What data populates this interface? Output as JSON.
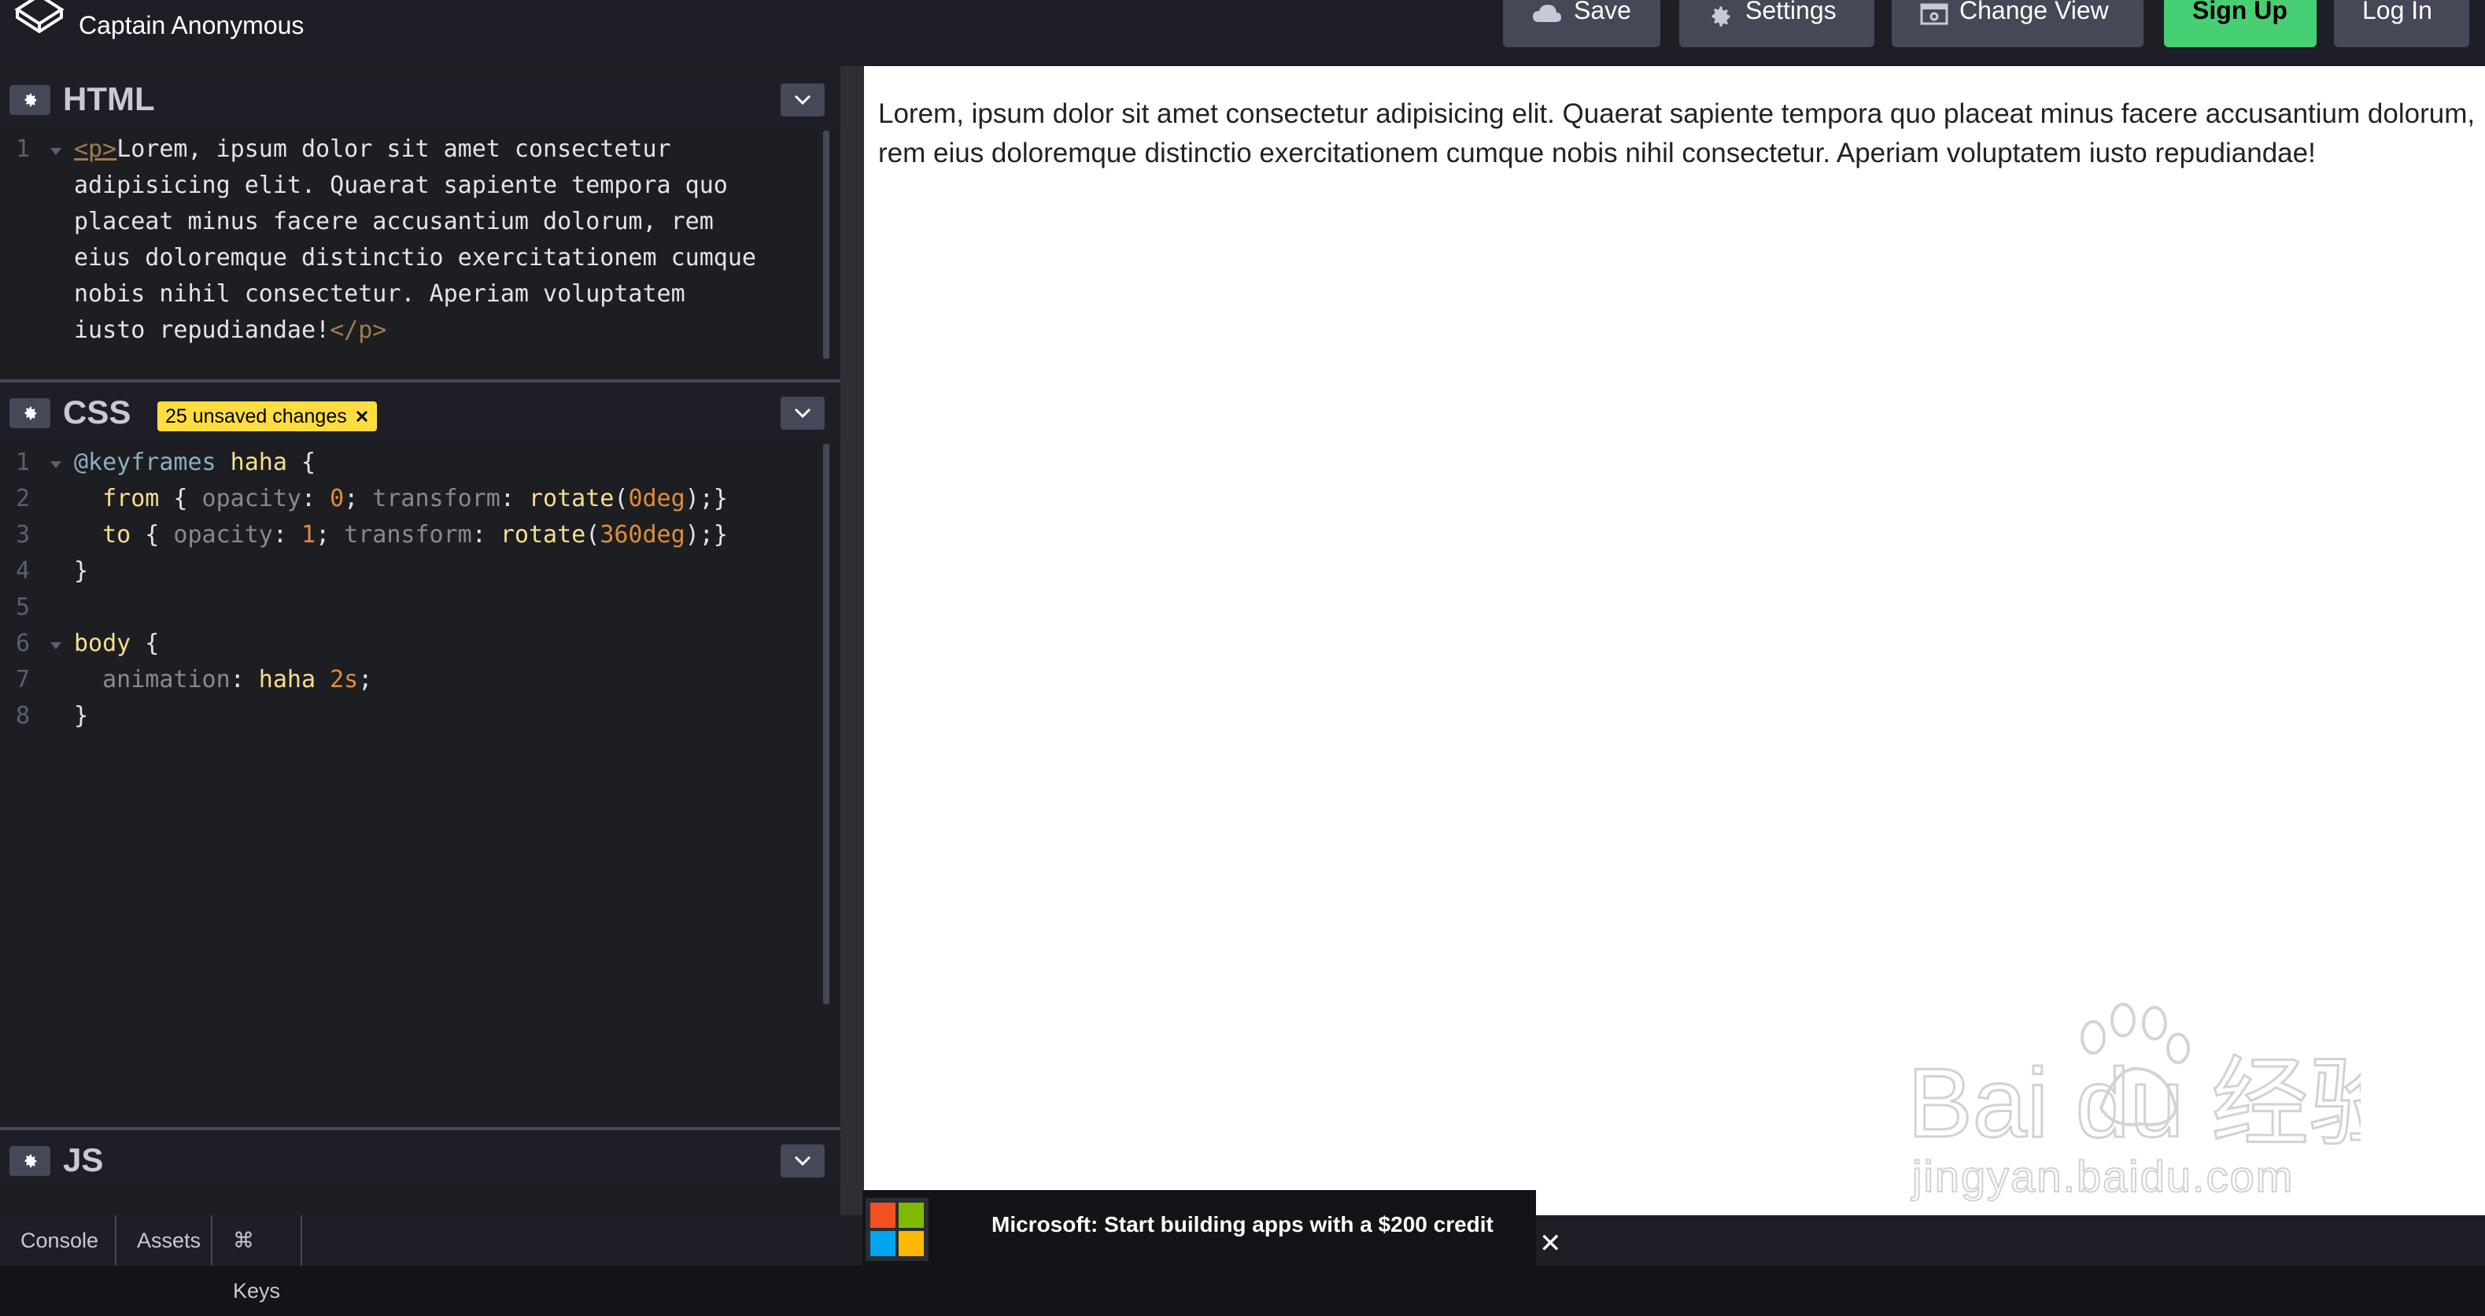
{
  "header": {
    "owner": "Captain Anonymous",
    "buttons": {
      "save": "Save",
      "settings": "Settings",
      "change_view": "Change View",
      "sign_up": "Sign Up",
      "log_in": "Log In"
    }
  },
  "panels": {
    "html": {
      "title": "HTML",
      "lines": [
        {
          "num": "1",
          "open": "<p>",
          "text": "Lorem, ipsum dolor sit amet consectetur"
        },
        {
          "text": "adipisicing elit. Quaerat sapiente tempora quo"
        },
        {
          "text": "placeat minus facere accusantium dolorum, rem"
        },
        {
          "text": "eius doloremque distinctio exercitationem cumque"
        },
        {
          "text": "nobis nihil consectetur. Aperiam voluptatem"
        },
        {
          "text": "iusto repudiandae!",
          "close": "</p>"
        }
      ]
    },
    "css": {
      "title": "CSS",
      "badge": "25 unsaved changes",
      "lines": [
        {
          "num": "1",
          "a": "@keyframes",
          "b": " haha",
          "c": " {"
        },
        {
          "num": "2",
          "from": "from",
          "p1": " {",
          "opacity": " opacity",
          "c1": ":",
          "v1": " 0",
          "s1": ";",
          "transform": " transform",
          "c2": ":",
          "fn": " rotate",
          "o": "(",
          "v2": "0deg",
          "e": ");}"
        },
        {
          "num": "3",
          "from": "to",
          "p1": " {",
          "opacity": " opacity",
          "c1": ":",
          "v1": " 1",
          "s1": ";",
          "transform": " transform",
          "c2": ":",
          "fn": " rotate",
          "o": "(",
          "v2": "360deg",
          "e": ");}"
        },
        {
          "num": "4",
          "text": "}"
        },
        {
          "num": "5",
          "text": ""
        },
        {
          "num": "6",
          "sel": "body",
          "brace": " {"
        },
        {
          "num": "7",
          "prop": "  animation",
          "colon": ":",
          "val": " haha",
          "dur": " 2s",
          "semi": ";"
        },
        {
          "num": "8",
          "text": "}"
        }
      ]
    },
    "js": {
      "title": "JS"
    }
  },
  "preview": {
    "paragraph": "Lorem, ipsum dolor sit amet consectetur adipisicing elit. Quaerat sapiente tempora quo placeat minus facere accusantium dolorum, rem eius doloremque distinctio exercitationem cumque nobis nihil consectetur. Aperiam voluptatem iusto repudiandae!"
  },
  "footer": {
    "console": "Console",
    "assets": "Assets",
    "keys": "⌘ Keys"
  },
  "ad": {
    "text": "Microsoft: Start building apps with a $200 credit",
    "close": "✕",
    "colors": [
      "#f25022",
      "#7fba00",
      "#00a4ef",
      "#ffb900"
    ]
  },
  "watermark": {
    "text": "Bai du 经验",
    "url": "jingyan.baidu.com"
  },
  "colors": {
    "signup": "#47cf73",
    "badge": "#ffdd40",
    "button": "#444857"
  }
}
